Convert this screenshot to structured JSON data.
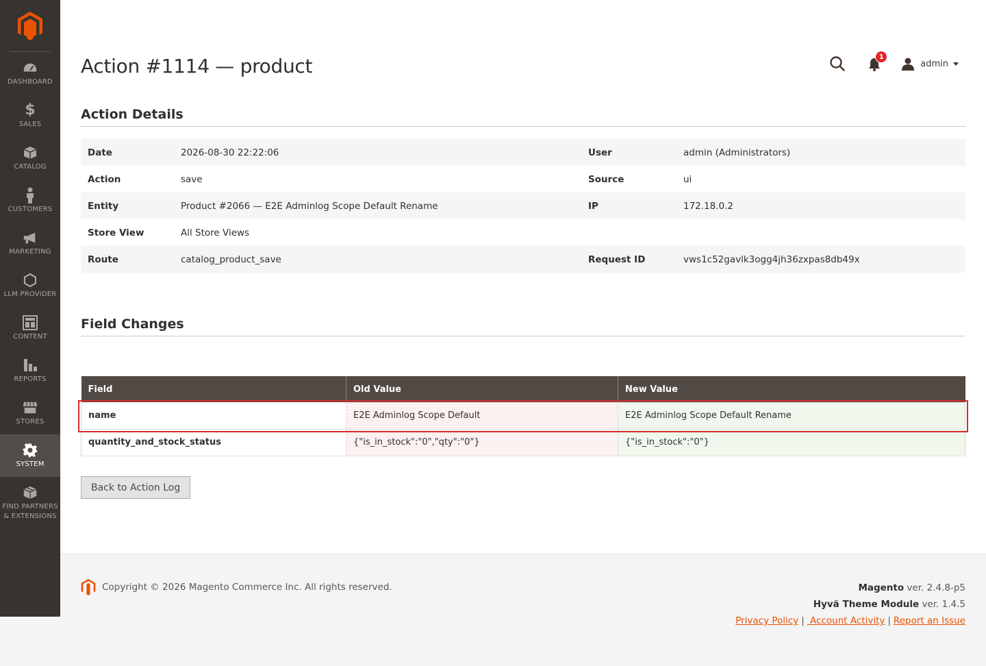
{
  "sidebar": {
    "items": [
      {
        "label": "DASHBOARD",
        "icon": "dashboard-icon"
      },
      {
        "label": "SALES",
        "icon": "dollar-icon"
      },
      {
        "label": "CATALOG",
        "icon": "box-icon"
      },
      {
        "label": "CUSTOMERS",
        "icon": "person-icon"
      },
      {
        "label": "MARKETING",
        "icon": "megaphone-icon"
      },
      {
        "label": "LLM PROVIDER",
        "icon": "hexagon-icon"
      },
      {
        "label": "CONTENT",
        "icon": "layout-icon"
      },
      {
        "label": "REPORTS",
        "icon": "bar-chart-icon"
      },
      {
        "label": "STORES",
        "icon": "store-icon"
      },
      {
        "label": "SYSTEM",
        "icon": "gear-icon",
        "active": true
      },
      {
        "label": "FIND PARTNERS & EXTENSIONS",
        "icon": "boxes-icon"
      }
    ]
  },
  "header": {
    "title": "Action #1114 — product",
    "notification_count": "1",
    "user": "admin"
  },
  "details": {
    "section_title": "Action Details",
    "rows": [
      {
        "label": "Date",
        "value": "2026-08-30 22:22:06",
        "label2": "User",
        "value2": "admin (Administrators)"
      },
      {
        "label": "Action",
        "value": "save",
        "label2": "Source",
        "value2": "ui"
      },
      {
        "label": "Entity",
        "value": "Product #2066 — E2E Adminlog Scope Default Rename",
        "label2": "IP",
        "value2": "172.18.0.2"
      },
      {
        "label": "Store View",
        "value": "All Store Views",
        "label2": "",
        "value2": ""
      },
      {
        "label": "Route",
        "value": "catalog_product_save",
        "label2": "Request ID",
        "value2": "vws1c52gavlk3ogg4jh36zxpas8db49x"
      }
    ]
  },
  "changes": {
    "section_title": "Field Changes",
    "headers": [
      "Field",
      "Old Value",
      "New Value"
    ],
    "rows": [
      {
        "field": "name",
        "old": "E2E Adminlog Scope Default",
        "new": "E2E Adminlog Scope Default Rename"
      },
      {
        "field": "quantity_and_stock_status",
        "old": "{\"is_in_stock\":\"0\",\"qty\":\"0\"}",
        "new": "{\"is_in_stock\":\"0\"}"
      }
    ]
  },
  "back_button": "Back to Action Log",
  "footer": {
    "copyright": "Copyright © 2026 Magento Commerce Inc. All rights reserved.",
    "magento_label": "Magento",
    "magento_version": " ver. 2.4.8-p5",
    "hyva_label": "Hyvä Theme Module",
    "hyva_version": " ver. 1.4.5",
    "links": [
      "Privacy Policy",
      " Account Activity",
      "Report an Issue"
    ],
    "separator": "|"
  },
  "colors": {
    "sidebar": "#373330",
    "accent": "#eb5202",
    "table_header": "#514943",
    "old_value_bg": "#fdf0f0",
    "new_value_bg": "#f0f8ee",
    "highlight": "#d52c2c"
  }
}
